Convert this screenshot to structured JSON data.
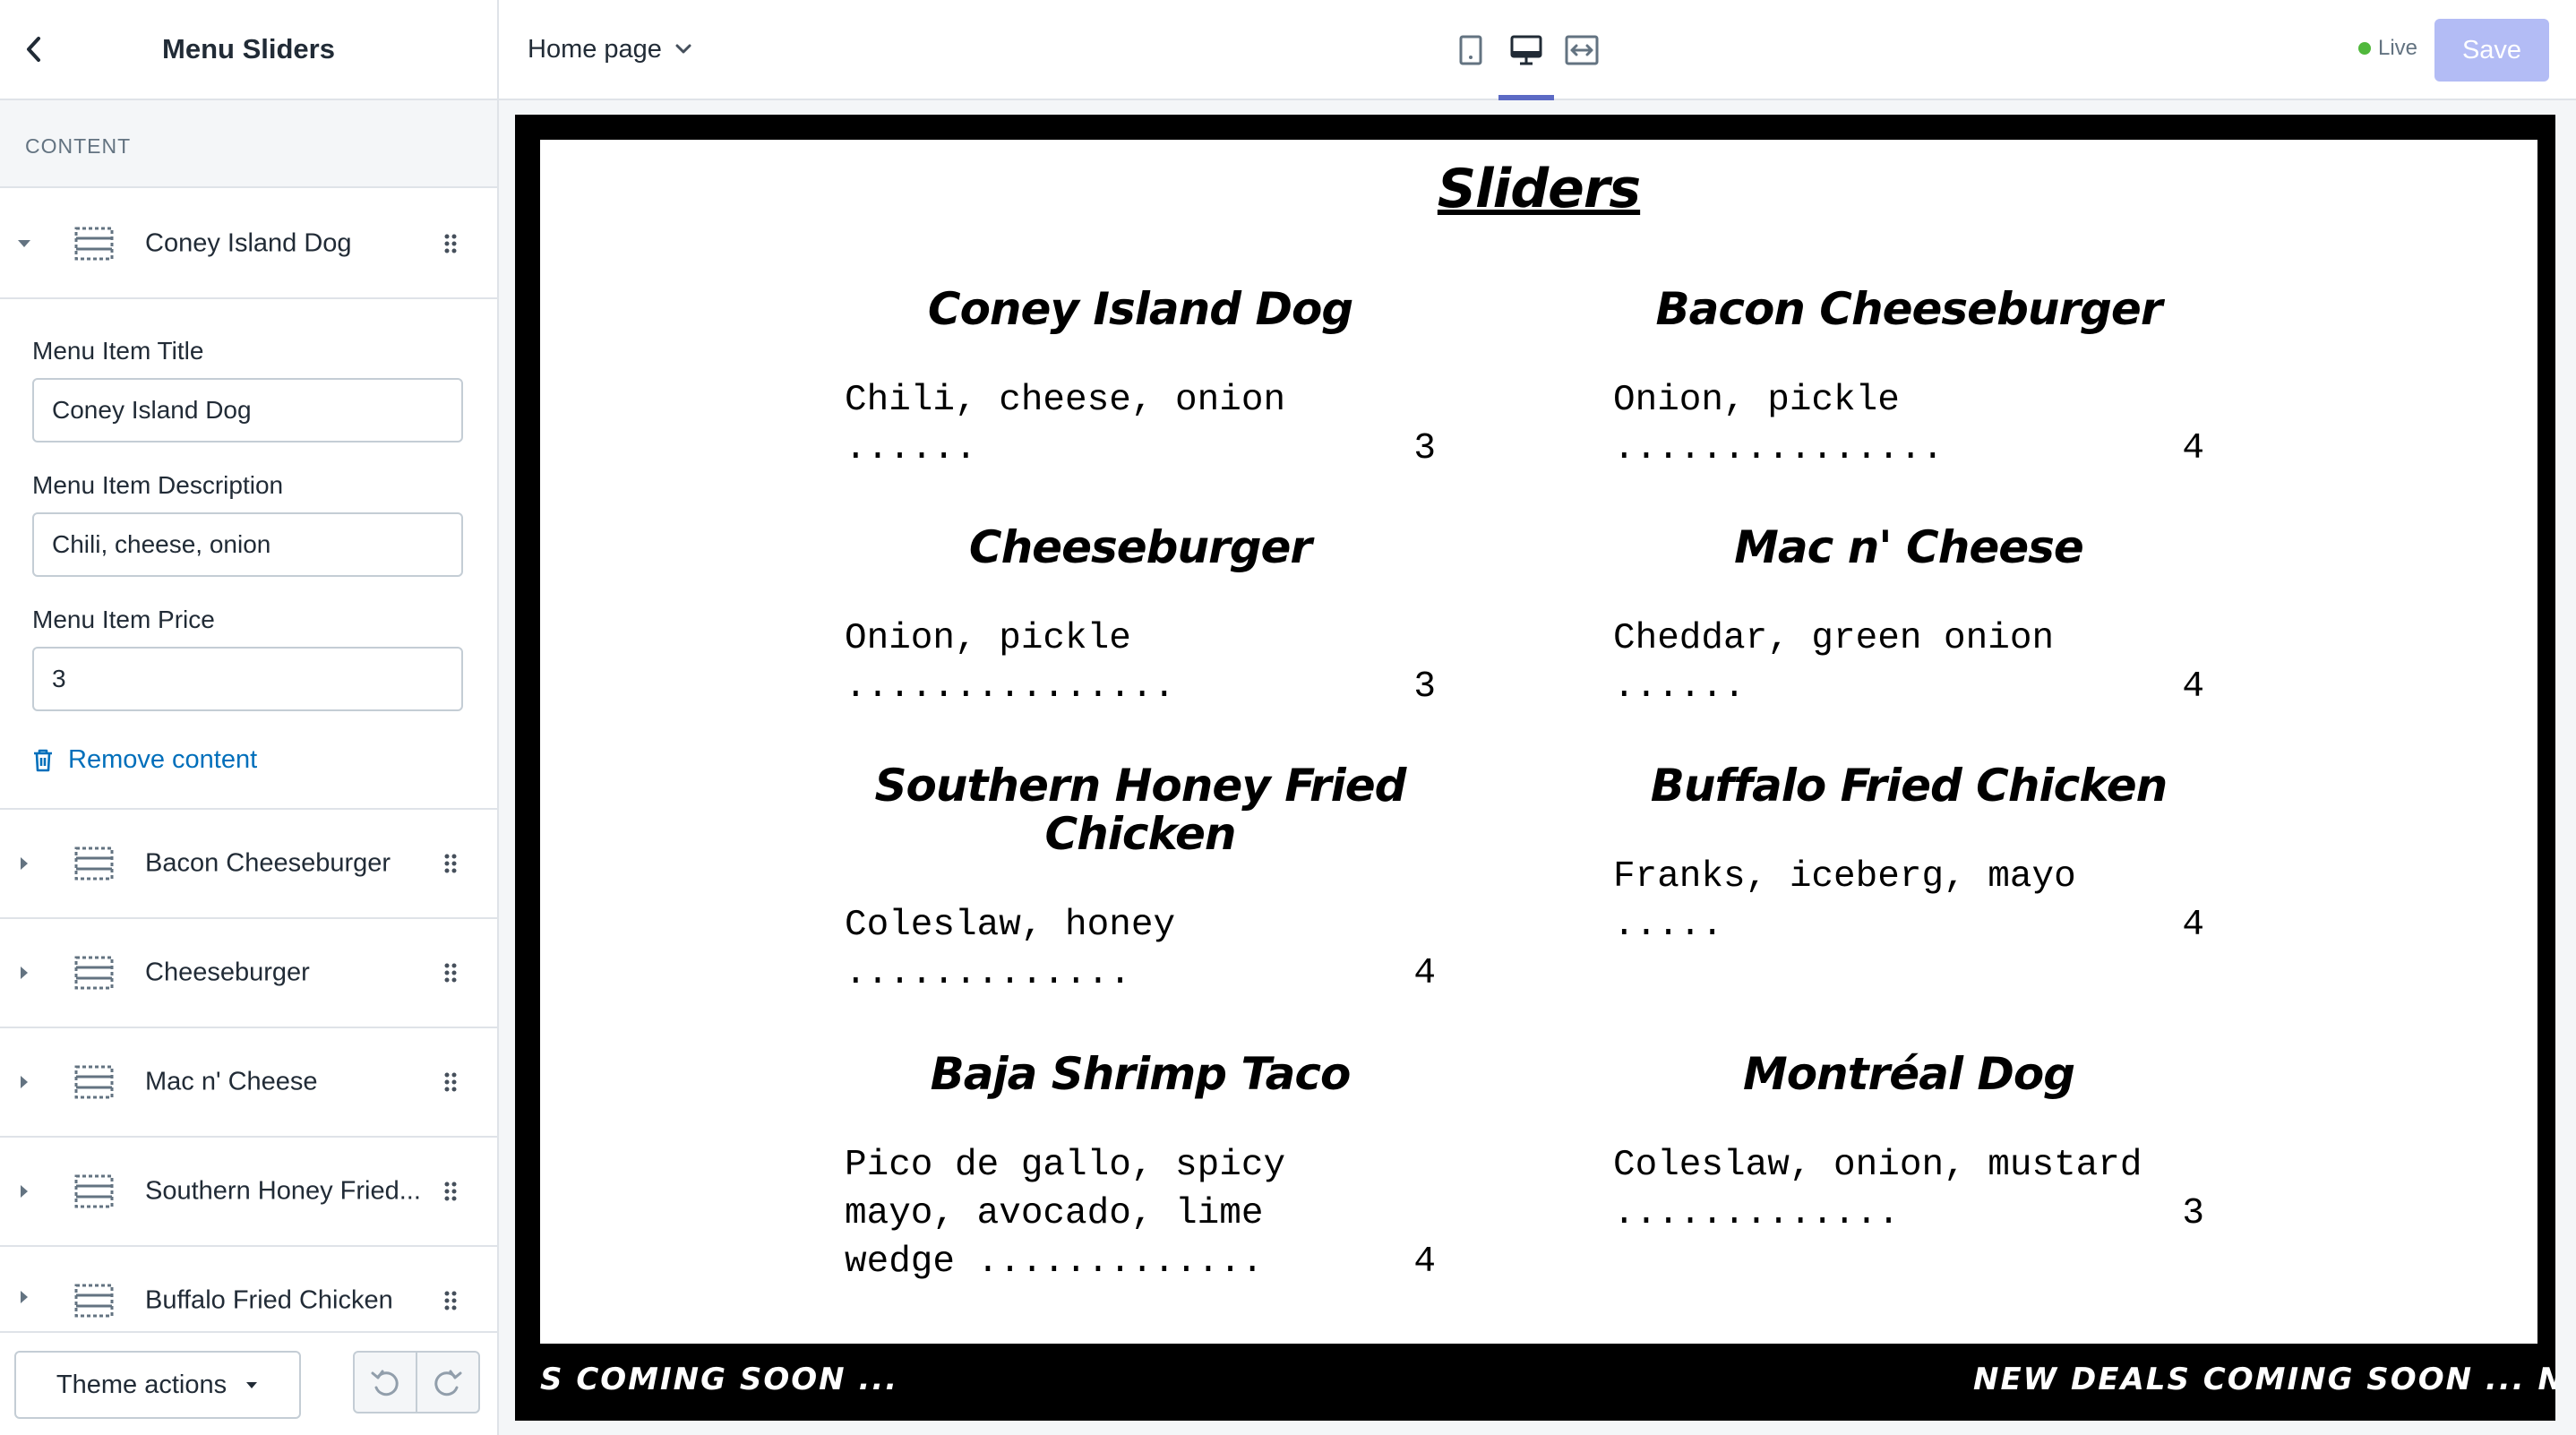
{
  "sidebar": {
    "title": "Menu Sliders",
    "section_label": "CONTENT",
    "active_block": {
      "label": "Coney Island Dog"
    },
    "editor": {
      "title_label": "Menu Item Title",
      "title_value": "Coney Island Dog",
      "description_label": "Menu Item Description",
      "description_value": "Chili, cheese, onion",
      "price_label": "Menu Item Price",
      "price_value": "3",
      "remove_label": "Remove content"
    },
    "blocks": [
      {
        "label": "Bacon Cheeseburger"
      },
      {
        "label": "Cheeseburger"
      },
      {
        "label": "Mac n' Cheese"
      },
      {
        "label": "Southern Honey Fried..."
      },
      {
        "label": "Buffalo Fried Chicken"
      }
    ],
    "footer": {
      "theme_actions_label": "Theme actions"
    }
  },
  "topbar": {
    "page_select": "Home page",
    "live_label": "Live",
    "save_label": "Save",
    "colors": {
      "accent": "#5c6ac4",
      "save_disabled": "#b3bcf5",
      "live": "#50b83c"
    }
  },
  "preview": {
    "title": "Sliders",
    "items": [
      {
        "name": "Coney Island Dog",
        "desc": "Chili, cheese, onion",
        "price": "3"
      },
      {
        "name": "Bacon Cheeseburger",
        "desc": "Onion, pickle",
        "price": "4"
      },
      {
        "name": "Cheeseburger",
        "desc": "Onion, pickle",
        "price": "3"
      },
      {
        "name": "Mac n' Cheese",
        "desc": "Cheddar, green onion",
        "price": "4"
      },
      {
        "name": "Southern Honey Fried Chicken",
        "desc": "Coleslaw, honey",
        "price": "4"
      },
      {
        "name": "Buffalo Fried Chicken",
        "desc": "Franks, iceberg, mayo",
        "price": "4"
      },
      {
        "name": "Baja Shrimp Taco",
        "desc": "Pico de gallo, spicy mayo, avocado, lime wedge",
        "price": "4"
      },
      {
        "name": "Montréal Dog",
        "desc": "Coleslaw, onion, mustard",
        "price": "3"
      }
    ],
    "ticker_left": "S COMING SOON ...",
    "ticker_right": "NEW DEALS COMING SOON ... NEW DEA"
  }
}
